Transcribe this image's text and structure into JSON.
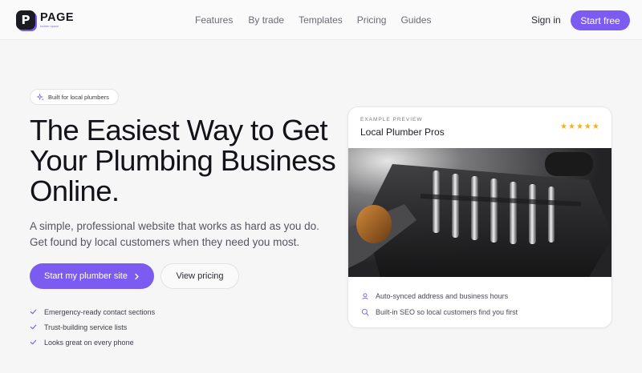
{
  "nav": {
    "logo_mark": "P",
    "logo_word": "PAGE",
    "logo_sub": "builder.space",
    "links": [
      "Features",
      "By trade",
      "Templates",
      "Pricing",
      "Guides"
    ],
    "signin": "Sign in",
    "cta": "Start free"
  },
  "hero": {
    "badge": "Built for local plumbers",
    "title": "The Easiest Way to Get Your Plumbing Business Online.",
    "lead": "A simple, professional website that works as hard as you do. Get found by local customers when they need you most.",
    "primary_cta": "Start my plumber site",
    "secondary_cta": "View pricing",
    "checklist": [
      "Emergency-ready contact sections",
      "Trust-building service lists",
      "Looks great on every phone"
    ]
  },
  "preview": {
    "eyebrow": "EXAMPLE PREVIEW",
    "title": "Local Plumber Pros",
    "rating_stars": 5,
    "features": [
      {
        "icon": "location-pin-icon",
        "text": "Auto-synced address and business hours"
      },
      {
        "icon": "search-icon",
        "text": "Built-in SEO so local customers find you first"
      }
    ]
  },
  "colors": {
    "accent": "#7c5cf0",
    "star": "#f2b319",
    "page_bg": "#f6f6f7"
  }
}
